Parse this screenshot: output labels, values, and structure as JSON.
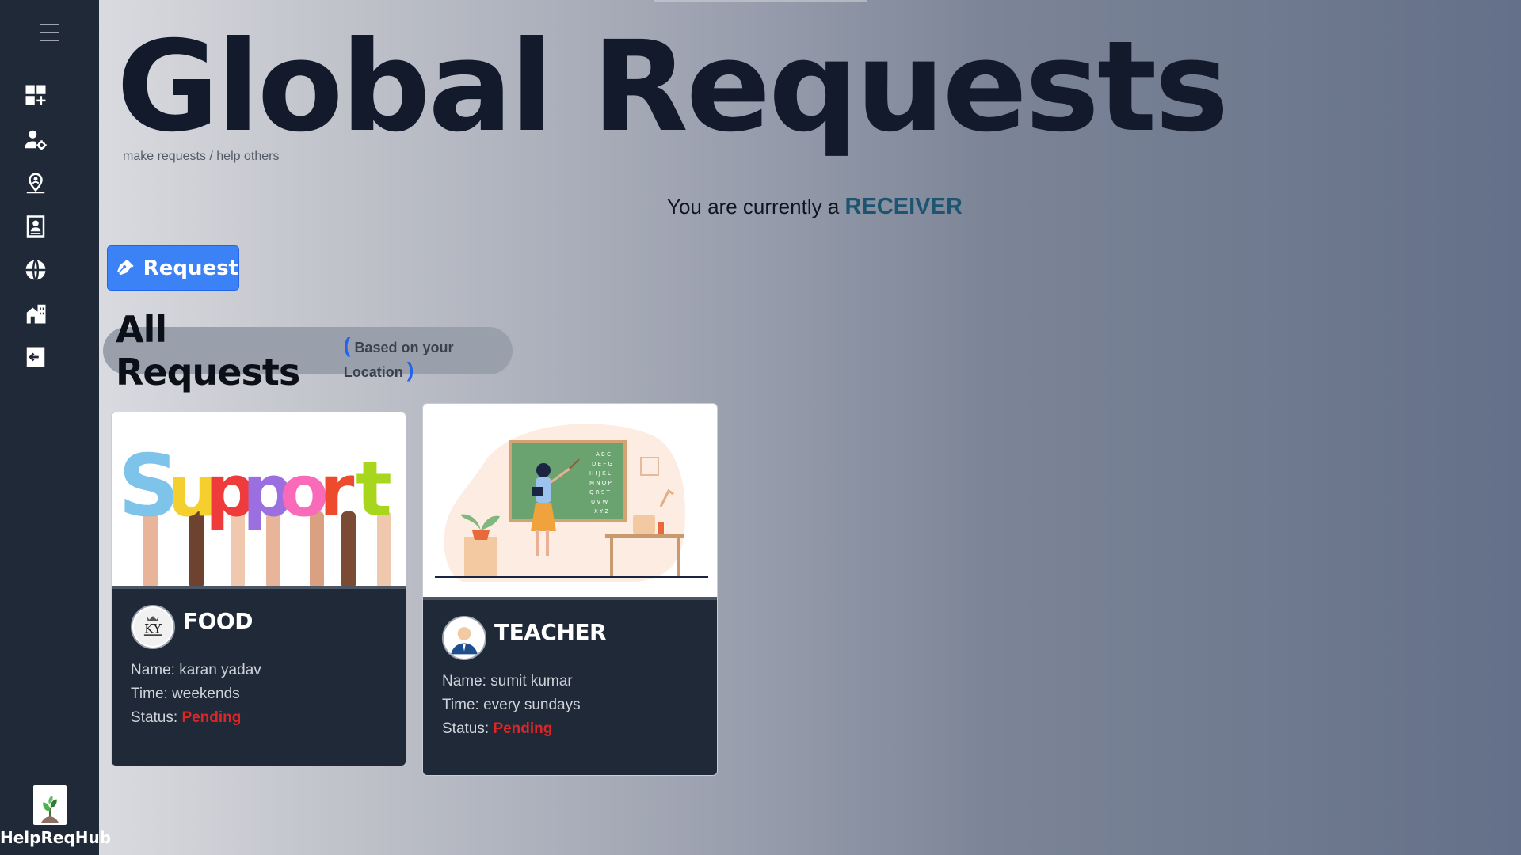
{
  "brand": {
    "name": "HelpReqHub"
  },
  "sidebar": {
    "items": [
      {
        "name": "dashboard-add-icon"
      },
      {
        "name": "user-settings-icon"
      },
      {
        "name": "location-person-icon"
      },
      {
        "name": "contact-book-icon"
      },
      {
        "name": "globe-icon"
      },
      {
        "name": "buildings-icon"
      },
      {
        "name": "logout-icon"
      }
    ]
  },
  "header": {
    "title": "Global Requests",
    "subtitle": "make requests / help others"
  },
  "role": {
    "prefix": "You are currently a",
    "value": "RECEIVER"
  },
  "request_button": {
    "label": "Request"
  },
  "section": {
    "title": "All Requests",
    "paren_open": "(",
    "subtitle": "Based on your Location",
    "paren_close": ")"
  },
  "cards": [
    {
      "title": "FOOD",
      "avatar_text": "KY",
      "image_text": "Support",
      "name_label": "Name:",
      "name": "karan yadav",
      "time_label": "Time:",
      "time": "weekends",
      "status_label": "Status:",
      "status": "Pending"
    },
    {
      "title": "TEACHER",
      "image_text": "",
      "name_label": "Name:",
      "name": "sumit kumar",
      "time_label": "Time:",
      "time": "every sundays",
      "status_label": "Status:",
      "status": "Pending"
    }
  ],
  "colors": {
    "sidebar_bg": "#1f2937",
    "title": "#121a2c",
    "accent": "#3b82f6",
    "role": "#1d5571",
    "status_pending": "#dc2626"
  }
}
